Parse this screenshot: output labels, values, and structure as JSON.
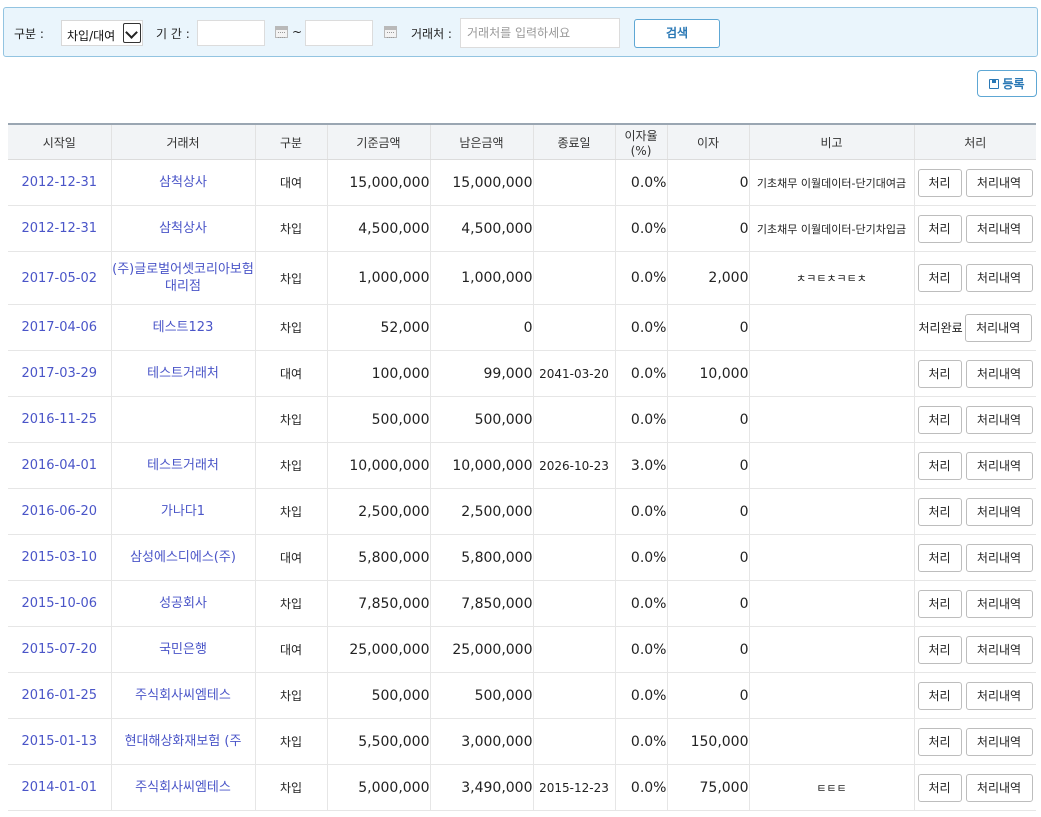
{
  "search": {
    "type_label": "구분 :",
    "type_value": "차입/대여",
    "period_label": "기 간 :",
    "tilde": "~",
    "counterparty_label": "거래처 :",
    "counterparty_placeholder": "거래처를 입력하세요",
    "search_button": "검색"
  },
  "register_button": "등록",
  "table": {
    "headers": {
      "start": "시작일",
      "party": "거래처",
      "type": "구분",
      "base": "기준금액",
      "remain": "남은금액",
      "end": "종료일",
      "rate": "이자율(%)",
      "interest": "이자",
      "note": "비고",
      "action": "처리"
    },
    "action_label": "처리",
    "history_label": "처리내역",
    "done_label": "처리완료",
    "rows": [
      {
        "start": "2012-12-31",
        "party": "삼척상사",
        "type": "대여",
        "base": "15,000,000",
        "remain": "15,000,000",
        "end": "",
        "rate": "0.0%",
        "interest": "0",
        "note": "기초채무 이월데이터-단기대여금",
        "done": false
      },
      {
        "start": "2012-12-31",
        "party": "삼척상사",
        "type": "차입",
        "base": "4,500,000",
        "remain": "4,500,000",
        "end": "",
        "rate": "0.0%",
        "interest": "0",
        "note": "기초채무 이월데이터-단기차입금",
        "done": false
      },
      {
        "start": "2017-05-02",
        "party": "(주)글로벌어셋코리아보험대리점",
        "type": "차입",
        "base": "1,000,000",
        "remain": "1,000,000",
        "end": "",
        "rate": "0.0%",
        "interest": "2,000",
        "note": "ㅊㅋㅌㅊㅋㅌㅊ",
        "done": false
      },
      {
        "start": "2017-04-06",
        "party": "테스트123",
        "type": "차입",
        "base": "52,000",
        "remain": "0",
        "end": "",
        "rate": "0.0%",
        "interest": "0",
        "note": "",
        "done": true
      },
      {
        "start": "2017-03-29",
        "party": "테스트거래처",
        "type": "대여",
        "base": "100,000",
        "remain": "99,000",
        "end": "2041-03-20",
        "rate": "0.0%",
        "interest": "10,000",
        "note": "",
        "done": false
      },
      {
        "start": "2016-11-25",
        "party": "",
        "type": "차입",
        "base": "500,000",
        "remain": "500,000",
        "end": "",
        "rate": "0.0%",
        "interest": "0",
        "note": "",
        "done": false
      },
      {
        "start": "2016-04-01",
        "party": "테스트거래처",
        "type": "차입",
        "base": "10,000,000",
        "remain": "10,000,000",
        "end": "2026-10-23",
        "rate": "3.0%",
        "interest": "0",
        "note": "",
        "done": false
      },
      {
        "start": "2016-06-20",
        "party": "가나다1",
        "type": "차입",
        "base": "2,500,000",
        "remain": "2,500,000",
        "end": "",
        "rate": "0.0%",
        "interest": "0",
        "note": "",
        "done": false
      },
      {
        "start": "2015-03-10",
        "party": "삼성에스디에스(주)",
        "type": "대여",
        "base": "5,800,000",
        "remain": "5,800,000",
        "end": "",
        "rate": "0.0%",
        "interest": "0",
        "note": "",
        "done": false
      },
      {
        "start": "2015-10-06",
        "party": "성공회사",
        "type": "차입",
        "base": "7,850,000",
        "remain": "7,850,000",
        "end": "",
        "rate": "0.0%",
        "interest": "0",
        "note": "",
        "done": false
      },
      {
        "start": "2015-07-20",
        "party": "국민은행",
        "type": "대여",
        "base": "25,000,000",
        "remain": "25,000,000",
        "end": "",
        "rate": "0.0%",
        "interest": "0",
        "note": "",
        "done": false
      },
      {
        "start": "2016-01-25",
        "party": "주식회사씨엠테스",
        "type": "차입",
        "base": "500,000",
        "remain": "500,000",
        "end": "",
        "rate": "0.0%",
        "interest": "0",
        "note": "",
        "done": false
      },
      {
        "start": "2015-01-13",
        "party": "현대해상화재보험 (주",
        "type": "차입",
        "base": "5,500,000",
        "remain": "3,000,000",
        "end": "",
        "rate": "0.0%",
        "interest": "150,000",
        "note": "",
        "done": false
      },
      {
        "start": "2014-01-01",
        "party": "주식회사씨엠테스",
        "type": "차입",
        "base": "5,000,000",
        "remain": "3,490,000",
        "end": "2015-12-23",
        "rate": "0.0%",
        "interest": "75,000",
        "note": "ㅌㅌㅌ",
        "done": false
      }
    ]
  }
}
